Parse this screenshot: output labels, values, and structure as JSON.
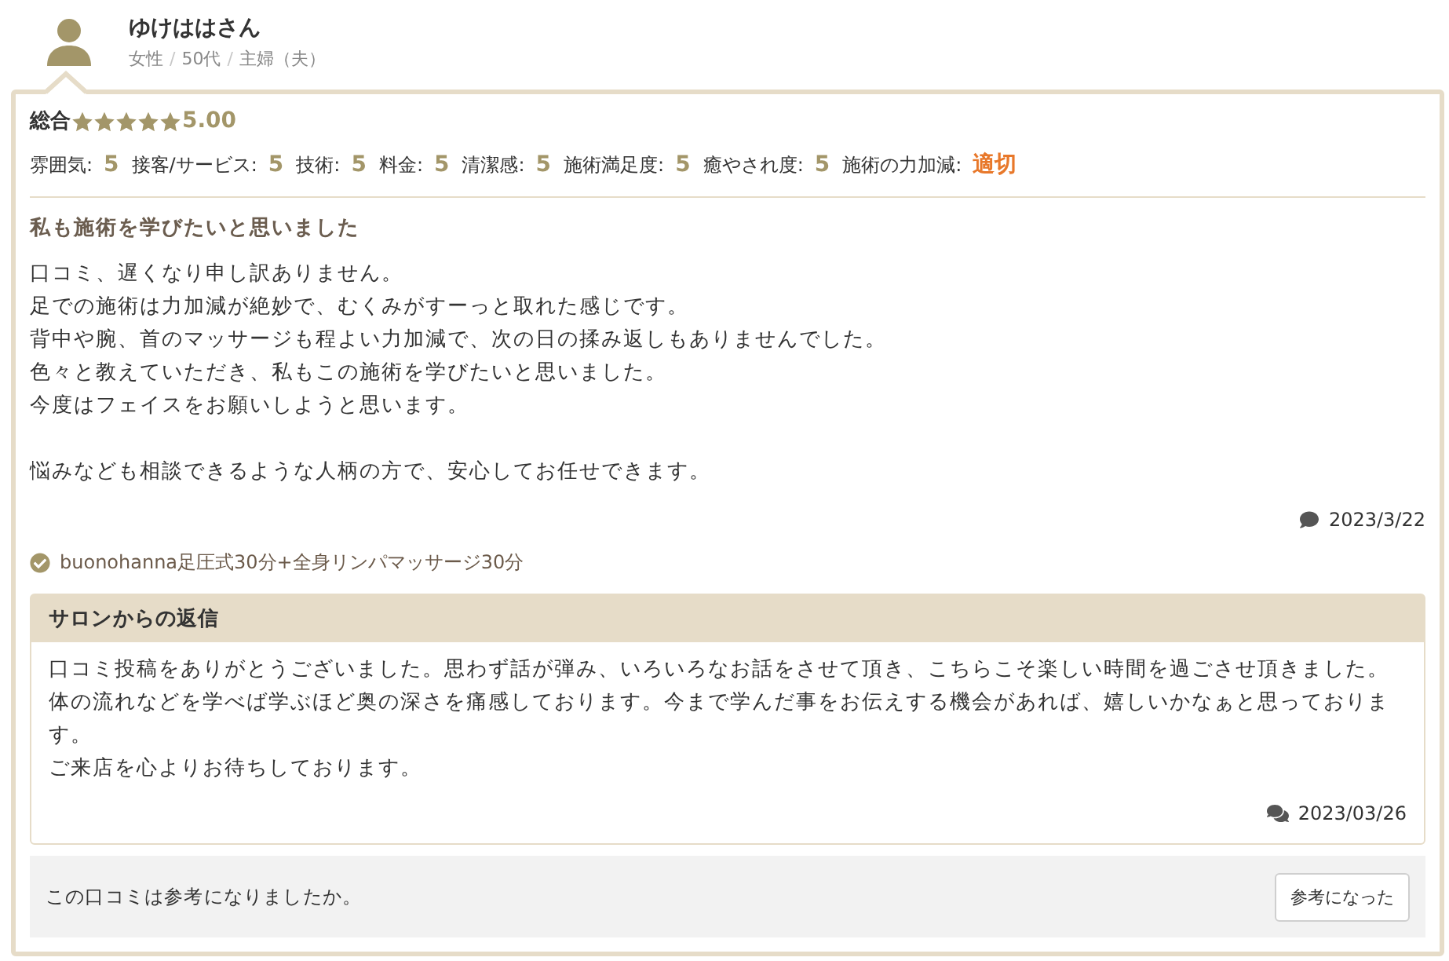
{
  "reviewer": {
    "name": "ゆけははさん",
    "details": [
      {
        "kind": "value",
        "text": "女性"
      },
      {
        "kind": "separator",
        "text": "/"
      },
      {
        "kind": "value",
        "text": "50代"
      },
      {
        "kind": "separator",
        "text": "/"
      },
      {
        "kind": "value",
        "text": "主婦（夫）"
      }
    ]
  },
  "review": {
    "overall": {
      "label": "総合",
      "stars": 5,
      "score": "5.00"
    },
    "ratings": [
      {
        "kind": "score",
        "label": "雰囲気:",
        "value": "5"
      },
      {
        "kind": "score",
        "label": "接客/サービス:",
        "value": "5"
      },
      {
        "kind": "score",
        "label": "技術:",
        "value": "5"
      },
      {
        "kind": "score",
        "label": "料金:",
        "value": "5"
      },
      {
        "kind": "score",
        "label": "清潔感:",
        "value": "5"
      },
      {
        "kind": "score",
        "label": "施術満足度:",
        "value": "5"
      },
      {
        "kind": "score",
        "label": "癒やされ度:",
        "value": "5"
      },
      {
        "kind": "word",
        "label": "施術の力加減:",
        "value": "適切"
      }
    ],
    "title": "私も施術を学びたいと思いました",
    "body": [
      [
        "口コミ、遅くなり申し訳ありません。",
        "足での施術は力加減が絶妙で、むくみがすーっと取れた感じです。",
        "背中や腕、首のマッサージも程よい力加減で、次の日の揉み返しもありませんでした。",
        "色々と教えていただき、私もこの施術を学びたいと思いました。",
        "今度はフェイスをお願いしようと思います。"
      ],
      [
        "悩みなども相談できるような人柄の方で、安心してお任せできます。"
      ]
    ],
    "date": "2023/3/22",
    "menu": "buonohanna足圧式30分+全身リンパマッサージ30分"
  },
  "reply": {
    "heading": "サロンからの返信",
    "lines": [
      "口コミ投稿をありがとうございました。思わず話が弾み、いろいろなお話をさせて頂き、こちらこそ楽しい時間を過ごさせ頂きました。",
      "体の流れなどを学べば学ぶほど奥の深さを痛感しております。今まで学んだ事をお伝えする機会があれば、嬉しいかなぁと思っております。",
      "ご来店を心よりお待ちしております。"
    ],
    "date": "2023/03/26"
  },
  "helpful": {
    "question": "この口コミは参考になりましたか。",
    "button": "参考になった"
  }
}
